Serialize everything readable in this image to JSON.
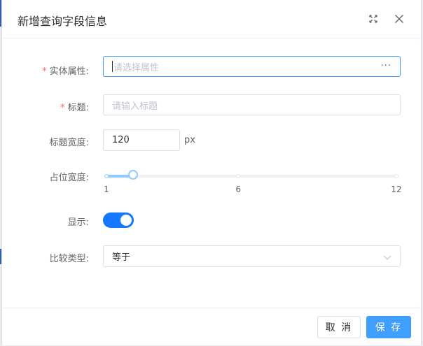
{
  "dialog": {
    "title": "新增查询字段信息"
  },
  "form": {
    "entity_attr": {
      "required_mark": "*",
      "label": "实体属性:",
      "placeholder": "请选择属性",
      "more_label": "···"
    },
    "title_field": {
      "required_mark": "*",
      "label": "标题:",
      "placeholder": "请输入标题"
    },
    "title_width": {
      "label": "标题宽度:",
      "value": "120",
      "unit": "px"
    },
    "span_width": {
      "label": "占位宽度:",
      "min": 1,
      "max": 12,
      "value": 2,
      "marks": [
        "1",
        "6",
        "12"
      ]
    },
    "display": {
      "label": "显示:",
      "on": true
    },
    "compare_type": {
      "label": "比较类型:",
      "value": "等于"
    }
  },
  "footer": {
    "cancel_label": "取 消",
    "save_label": "保 存"
  },
  "colors": {
    "primary": "#409eff",
    "switch_on": "#1677ff",
    "slider": "#91caff"
  }
}
